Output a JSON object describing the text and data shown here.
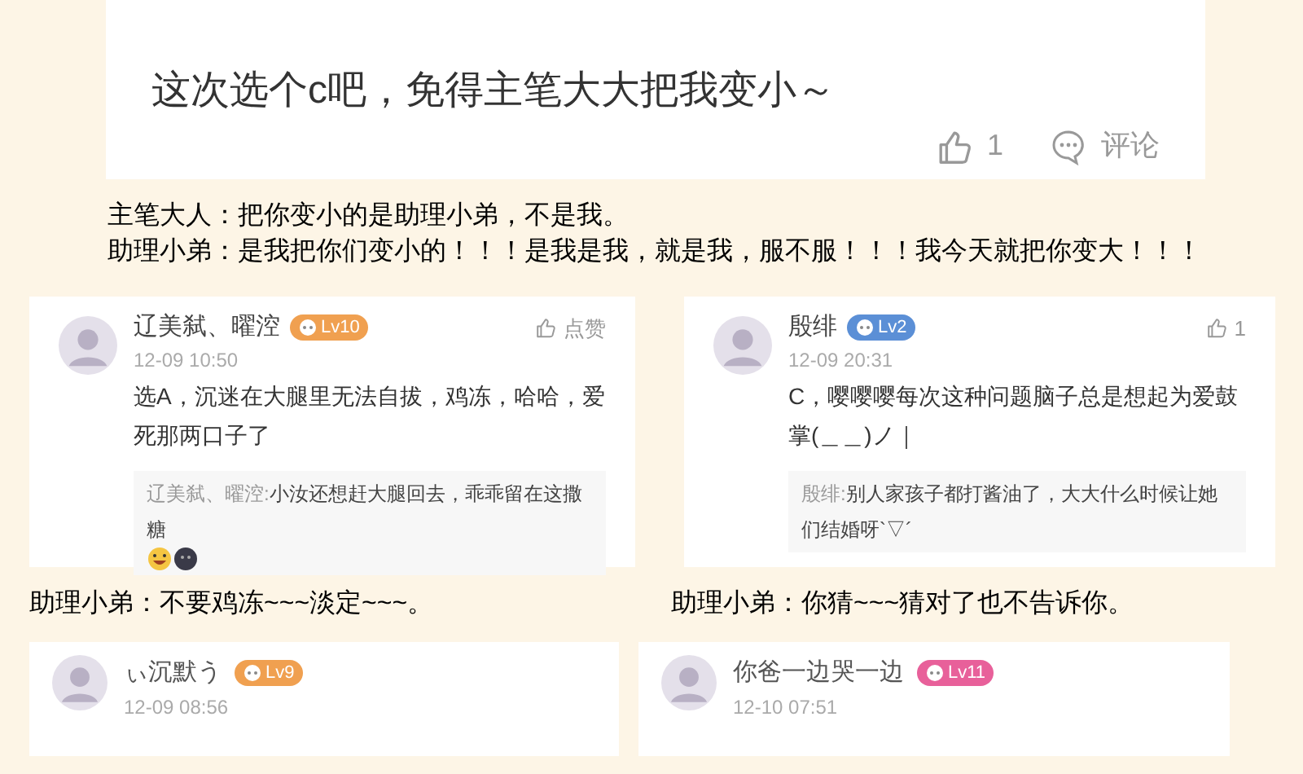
{
  "top_post": {
    "text": "这次选个c吧，免得主笔大大把我变小～",
    "likes": "1",
    "comment_label": "评论"
  },
  "dialogue": [
    {
      "speaker": "主笔大人：",
      "text": "把你变小的是助理小弟，不是我。"
    },
    {
      "speaker": "助理小弟：",
      "text": "是我把你们变小的！！！是我是我，就是我，服不服！！！我今天就把你变大！！！"
    }
  ],
  "columns": [
    {
      "comment": {
        "user": "辽美弑、曜涳",
        "level": "Lv10",
        "color": "#f0a050",
        "time": "12-09 10:50",
        "like": "点赞",
        "body": "选A，沉迷在大腿里无法自拔，鸡冻，哈哈，爱死那两口子了",
        "reply": {
          "user": "辽美弑、曜涳:",
          "text": "小汝还想赶大腿回去，乖乖留在这撒糖",
          "emojis": [
            {
              "kind": "laugh"
            },
            {
              "kind": "dark"
            }
          ]
        }
      },
      "caption": {
        "speaker": "助理小弟：",
        "text": "不要鸡冻~~~淡定~~~。"
      },
      "next": {
        "user": "ぃ沉默う",
        "level": "Lv9",
        "color": "#f0a050",
        "time": "12-09 08:56"
      }
    },
    {
      "comment": {
        "user": "殷绯",
        "level": "Lv2",
        "color": "#5b8fd6",
        "time": "12-09 20:31",
        "like": "1",
        "body": "C，嘤嘤嘤每次这种问题脑子总是想起为爱鼓掌(＿＿)ノ｜",
        "reply": {
          "user": "殷绯:",
          "text": "别人家孩子都打酱油了，大大什么时候让她们结婚呀`▽´"
        }
      },
      "caption": {
        "speaker": "助理小弟：",
        "text": "你猜~~~猜对了也不告诉你。"
      },
      "next": {
        "user": "你爸一边哭一边",
        "level": "Lv11",
        "color": "#e8609a",
        "time": "12-10 07:51"
      }
    }
  ]
}
